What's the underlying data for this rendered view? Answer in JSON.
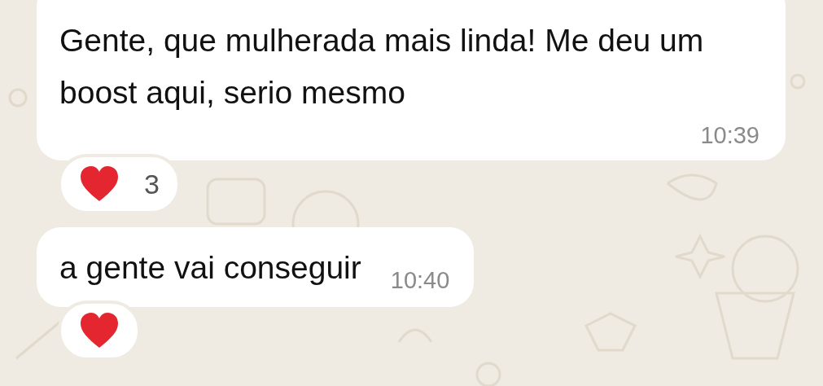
{
  "messages": [
    {
      "text": "Gente, que mulherada mais linda! Me deu um boost aqui, serio mesmo",
      "time": "10:39",
      "reaction": {
        "kind": "heart",
        "count": "3"
      }
    },
    {
      "text": "a gente vai conseguir",
      "time": "10:40",
      "reaction": {
        "kind": "heart"
      }
    }
  ]
}
